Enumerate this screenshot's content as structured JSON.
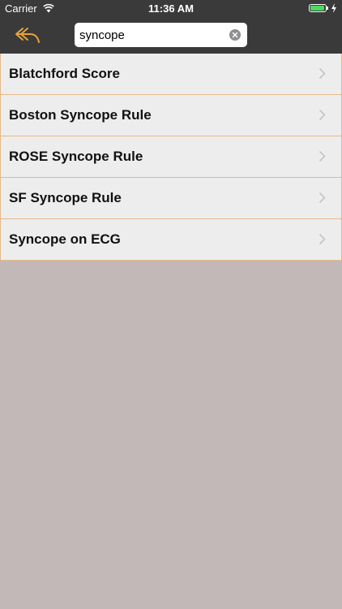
{
  "status_bar": {
    "carrier": "Carrier",
    "time": "11:36 AM",
    "battery_level": 0.95,
    "battery_color": "#4cd964"
  },
  "nav": {
    "back_icon": "reply-arrow-icon",
    "search": {
      "value": "syncope",
      "clear_icon": "clear-circle-icon"
    },
    "accent_color": "#e8a23a"
  },
  "results": [
    {
      "label": "Blatchford Score"
    },
    {
      "label": "Boston Syncope Rule"
    },
    {
      "label": "ROSE Syncope Rule"
    },
    {
      "label": "SF Syncope Rule"
    },
    {
      "label": "Syncope on ECG"
    }
  ],
  "colors": {
    "header_bg": "#3a3a3a",
    "list_bg": "#eeeded",
    "list_border": "#e6b887",
    "page_bg": "#c2b8b8"
  }
}
